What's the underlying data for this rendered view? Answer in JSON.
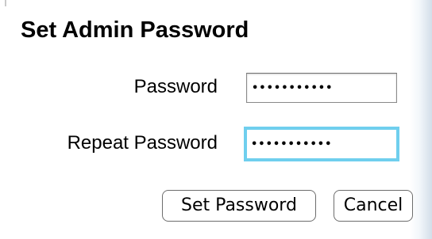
{
  "dialog": {
    "title": "Set Admin Password"
  },
  "fields": {
    "password": {
      "label": "Password",
      "value": "•••••••••••",
      "focused": false
    },
    "repeat_password": {
      "label": "Repeat Password",
      "value": "•••••••••••",
      "focused": true
    }
  },
  "buttons": {
    "set_password_label": "Set Password",
    "cancel_label": "Cancel"
  },
  "colors": {
    "focus_ring": "#6fcfee",
    "field_border": "#8a8a8a",
    "button_border": "#6d6d6d"
  }
}
